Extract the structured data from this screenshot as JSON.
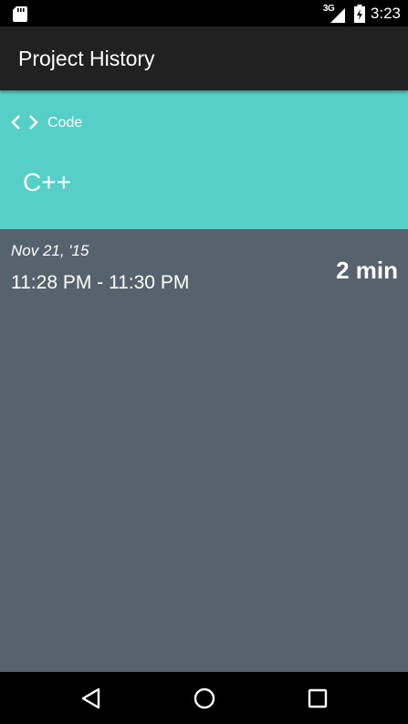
{
  "status_bar": {
    "network_type": "3G",
    "time": "3:23",
    "icons": [
      "sd-card-icon",
      "signal-icon",
      "battery-icon"
    ]
  },
  "app_bar": {
    "title": "Project History"
  },
  "project": {
    "category_icon": "code-icon",
    "category": "Code",
    "name": "C++",
    "color": "#56d0c6"
  },
  "history": [
    {
      "date": "Nov 21, '15",
      "time_range": "11:28 PM - 11:30 PM",
      "duration": "2 min"
    }
  ],
  "nav_bar": {
    "icons": [
      "back-icon",
      "home-icon",
      "recents-icon"
    ]
  },
  "colors": {
    "background": "#56636f",
    "app_bar": "#212121",
    "accent": "#56d0c6"
  }
}
